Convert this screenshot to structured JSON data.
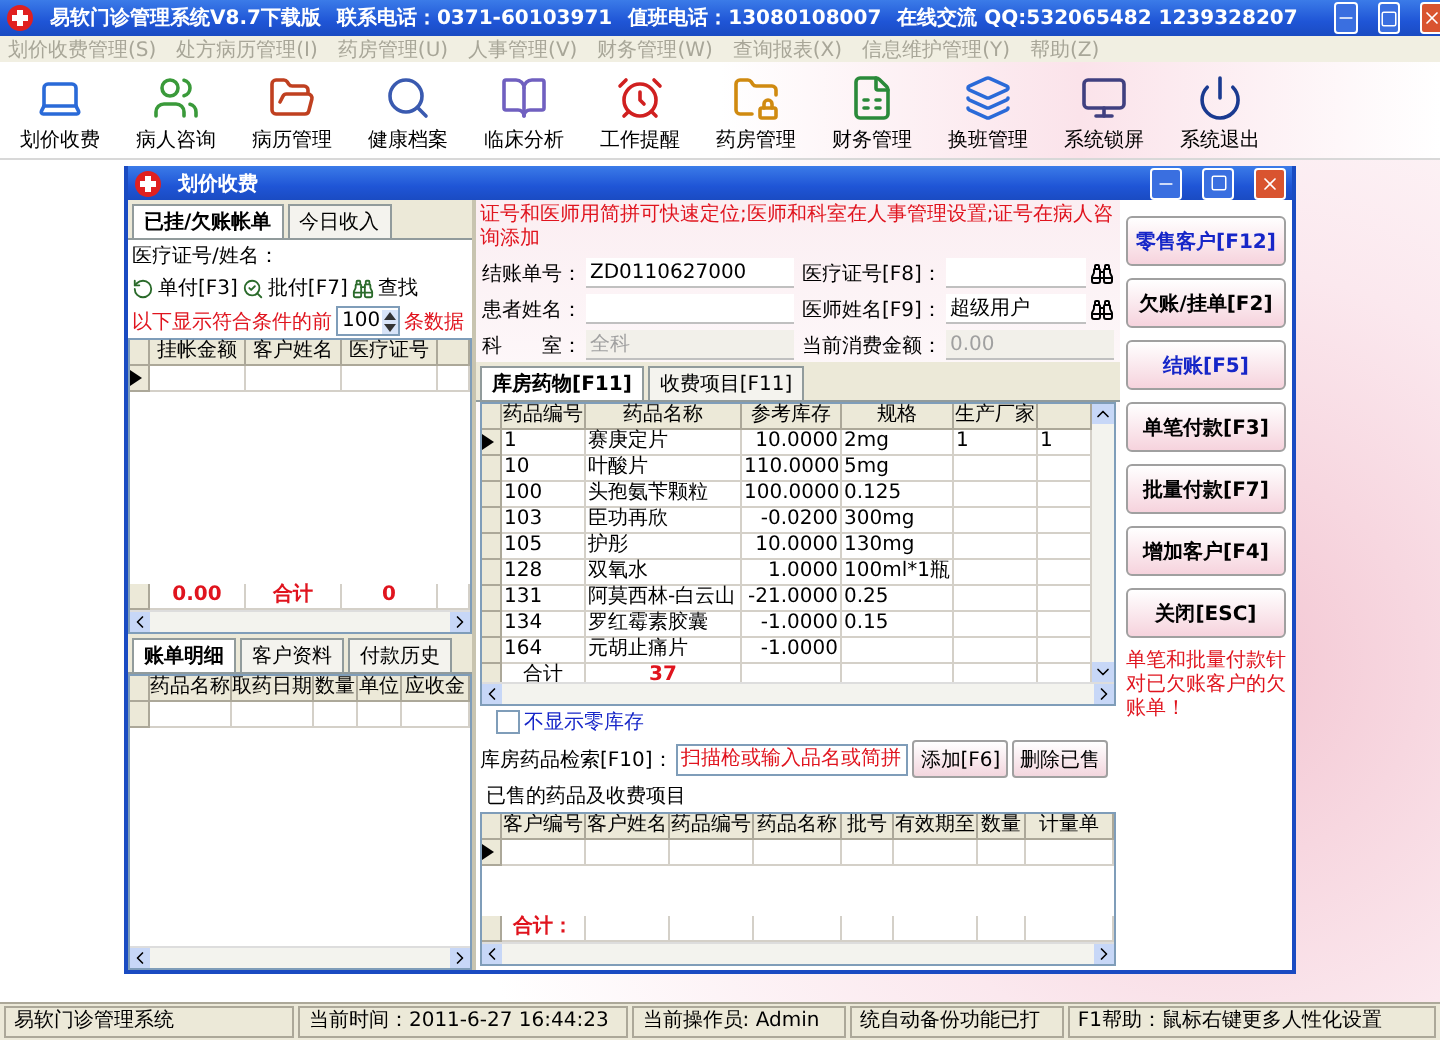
{
  "window": {
    "title": "易软门诊管理系统V8.7下载版",
    "contact": "联系电话：0371-60103971",
    "duty": "值班电话：13080108007",
    "chat": "在线交流  QQ:532065482 1239328207"
  },
  "menu": [
    {
      "label": "划价收费管理(S)",
      "disabled": true
    },
    {
      "label": "处方病历管理(I)",
      "disabled": true
    },
    {
      "label": "药房管理(U)",
      "disabled": true
    },
    {
      "label": "人事管理(V)",
      "disabled": true
    },
    {
      "label": "财务管理(W)",
      "disabled": true
    },
    {
      "label": "查询报表(X)",
      "disabled": true
    },
    {
      "label": "信息维护管理(Y)",
      "disabled": true
    },
    {
      "label": "帮助(Z)",
      "disabled": true
    }
  ],
  "toolbar": [
    "划价收费",
    "病人咨询",
    "病历管理",
    "健康档案",
    "临床分析",
    "工作提醒",
    "药房管理",
    "财务管理",
    "换班管理",
    "系统锁屏",
    "系统退出"
  ],
  "dialog": {
    "title": "划价收费",
    "left": {
      "tabs": [
        {
          "label": "已挂/欠账帐单",
          "selected": true
        },
        {
          "label": "今日收入",
          "selected": false
        }
      ],
      "search_label": "医疗证号/姓名：",
      "actions": [
        "单付[F3]",
        "批付[F7]",
        "查找"
      ],
      "limit_prefix": "以下显示符合条件的前",
      "limit_value": "100",
      "limit_suffix": "条数据",
      "columns": [
        "挂帐金额",
        "客户姓名",
        "医疗证号"
      ],
      "footer": [
        "0.00",
        "合计",
        "0"
      ],
      "detail_tabs": [
        {
          "label": "账单明细",
          "selected": true
        },
        {
          "label": "客户资料",
          "selected": false
        },
        {
          "label": "付款历史",
          "selected": false
        }
      ],
      "detail_columns": [
        "药品名称",
        "取药日期",
        "数量",
        "单位",
        "应收金"
      ]
    },
    "main": {
      "notice": "证号和医师用简拼可快速定位;医师和科室在人事管理设置;证号在病人咨询添加",
      "fields": [
        {
          "label": "结账单号：",
          "value": "ZD0110627000",
          "disabled": false,
          "lookup": false
        },
        {
          "label": "医疗证号[F8]：",
          "disabled": false,
          "lookup": true
        },
        {
          "label": "患者姓名：",
          "disabled": false,
          "lookup": false
        },
        {
          "label": "医师姓名[F9]：",
          "value": "超级用户",
          "disabled": false,
          "lookup": true
        },
        {
          "label": "科　　室：",
          "value": "全科",
          "disabled": true,
          "lookup": false
        },
        {
          "label": "当前消费金额：",
          "value": "0.00",
          "disabled": true,
          "lookup": false
        }
      ],
      "tabs": [
        {
          "label": "库房药物[F11]",
          "selected": true
        },
        {
          "label": "收费项目[F11]",
          "selected": false
        }
      ],
      "stock_columns": [
        "药品编号",
        "药品名称",
        "参考库存",
        "规格",
        "生产厂家"
      ],
      "stock_rows": [
        {
          "code": "1",
          "name": "赛庚定片",
          "stock": "10.0000",
          "spec": "2mg",
          "maker": "1",
          "column_6": "1"
        },
        {
          "code": "10",
          "name": "叶酸片",
          "stock": "110.0000",
          "spec": "5mg"
        },
        {
          "code": "100",
          "name": "头孢氨苄颗粒",
          "stock": "100.0000",
          "spec": "0.125"
        },
        {
          "code": "103",
          "name": "臣功再欣",
          "stock": "-0.0200",
          "spec": "300mg"
        },
        {
          "code": "105",
          "name": "护彤",
          "stock": "10.0000",
          "spec": "130mg"
        },
        {
          "code": "128",
          "name": "双氧水",
          "stock": "1.0000",
          "spec": "100ml*1瓶"
        },
        {
          "code": "131",
          "name": "阿莫西林-白云山",
          "stock": "-21.0000",
          "spec": "0.25"
        },
        {
          "code": "134",
          "name": "罗红霉素胶囊",
          "stock": "-1.0000",
          "spec": "0.15"
        },
        {
          "code": "164",
          "name": "元胡止痛片",
          "stock": "-1.0000"
        }
      ],
      "stock_footer": [
        "合计",
        "37"
      ],
      "hide_zero_stock": {
        "label": "不显示零库存",
        "checked": false
      },
      "search": {
        "label": "库房药品检索[F10]：",
        "placeholder": "扫描枪或输入品名或简拼"
      },
      "add_button": "添加[F6]",
      "delete_button": "删除已售",
      "sold_title": "已售的药品及收费项目",
      "sold_columns": [
        "客户编号",
        "客户姓名",
        "药品编号",
        "药品名称",
        "批号",
        "有效期至",
        "数量",
        "计量单"
      ],
      "sold_footer": "合计："
    },
    "buttons": [
      {
        "label": "零售客户[F12]",
        "highlight": true
      },
      {
        "label": "欠账/挂单[F2]",
        "highlight": false
      },
      {
        "label": "结账[F5]",
        "highlight": true
      },
      {
        "label": "单笔付款[F3]",
        "highlight": false
      },
      {
        "label": "批量付款[F7]",
        "highlight": false
      },
      {
        "label": "增加客户[F4]",
        "highlight": false
      },
      {
        "label": "关闭[ESC]",
        "highlight": false
      }
    ],
    "note": "单笔和批量付款针对已欠账客户的欠账单！"
  },
  "status_bar": [
    "易软门诊管理系统",
    "当前时间：2011-6-27 16:44:23",
    "当前操作员: Admin",
    "统自动备份功能已打",
    "F1帮助：鼠标右键更多人性化设置"
  ]
}
